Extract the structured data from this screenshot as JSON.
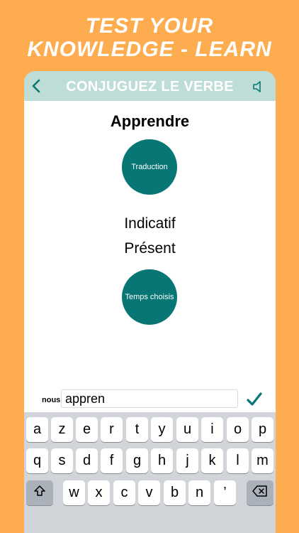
{
  "promo": {
    "line1": "TEST YOUR",
    "line2": "KNOWLEDGE - LEARN"
  },
  "navbar": {
    "title": "CONJUGUEZ LE VERBE",
    "back_icon": "chevron-left-icon",
    "sound_icon": "speaker-icon"
  },
  "exercise": {
    "verb": "Apprendre",
    "translation_button": "Traduction",
    "mood": "Indicatif",
    "tense": "Présent",
    "tense_button": "Temps choisis",
    "pronoun": "nous",
    "answer_value": "appren",
    "submit_icon": "checkmark-icon"
  },
  "keyboard": {
    "row1": [
      "a",
      "z",
      "e",
      "r",
      "t",
      "y",
      "u",
      "i",
      "o",
      "p"
    ],
    "row2": [
      "q",
      "s",
      "d",
      "f",
      "g",
      "h",
      "j",
      "k",
      "l",
      "m"
    ],
    "row3": [
      "w",
      "x",
      "c",
      "v",
      "b",
      "n",
      "’"
    ],
    "shift_icon": "shift-icon",
    "backspace_icon": "backspace-icon"
  },
  "colors": {
    "background": "#FDAD4F",
    "navbar": "#BFDDD7",
    "accent": "#077674",
    "keyboard": "#D1D4D9"
  }
}
